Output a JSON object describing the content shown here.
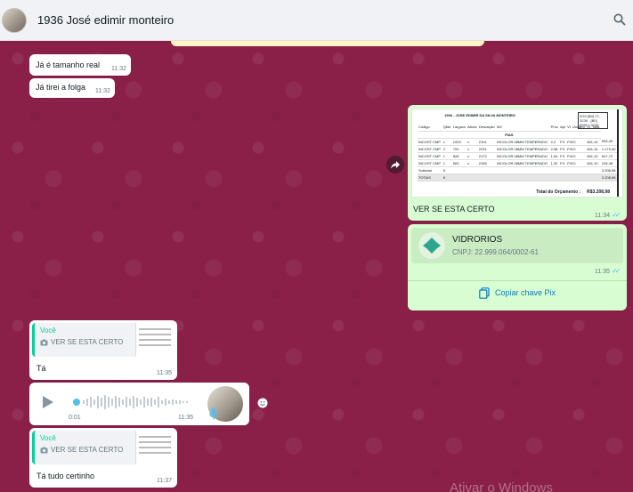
{
  "header": {
    "title": "1936 José edimir monteiro",
    "search_icon": "search-icon"
  },
  "messages": {
    "m1": {
      "text": "Já é tamanho real",
      "time": "11:32"
    },
    "m2": {
      "text": "Já tirei a folga",
      "time": "11:32"
    },
    "img": {
      "caption": "VER SE ESTA CERTO",
      "time": "11:34",
      "doc": {
        "title": "1936 - JOSE EDIMIR DA SILVA MONTEIRO",
        "code": "3/23 [B0] 17- 3239 - [B0] 00917-3239",
        "columns": [
          "Código",
          "Qtde",
          "Largura",
          "Altura",
          "Descrição",
          "M2",
          "Proc",
          "Apl",
          "Vl. Unitário",
          "Vl. Total"
        ],
        "group": "PIAS",
        "rows": [
          [
            "INCOST CMP",
            "1",
            "1003",
            "x",
            "2101",
            "INCOLOR 08MM TEMPERADO",
            "2,2",
            "FX",
            "FIXO",
            "461,10",
            "993,45"
          ],
          [
            "INCOST CMP",
            "2",
            "700",
            "x",
            "2231",
            "INCOLOR 08MM TEMPERADO",
            "2,98",
            "FX",
            "FIXO",
            "461,10",
            "1.179,39"
          ],
          [
            "INCOST CMP",
            "1",
            "826",
            "x",
            "2172",
            "INCOLOR 08MM TEMPERADO",
            "1,94",
            "FX",
            "FIXO",
            "461,10",
            "817,72"
          ],
          [
            "INCOST CMP",
            "1",
            "563",
            "x",
            "2155",
            "INCOLOR 08MM TEMPERADO",
            "1,32",
            "FX",
            "FIXO",
            "461,10",
            "228,48"
          ]
        ],
        "subtotal_label": "Subtotal",
        "subtotal_qty": "5",
        "subtotal_value": "3.208,98",
        "totais_label": "TOTAIS",
        "totais_qty": "5",
        "totais_value": "3.208,98",
        "total_label": "Total do Orçamento :",
        "total_value": "R$3.208,98"
      }
    },
    "pix": {
      "name": "VIDRORIOS",
      "cnpj": "CNPJ: 22.999.064/0002-61",
      "time": "11:35",
      "copy_label": "Copiar chave Pix"
    },
    "q1": {
      "author": "Você",
      "quoted_text": "VER SE ESTA CERTO",
      "text": "Tá",
      "time": "11:35"
    },
    "audio": {
      "duration": "0:01",
      "time": "11:35"
    },
    "q2": {
      "author": "Você",
      "quoted_text": "VER SE ESTA CERTO",
      "text": "Tá tudo certinho",
      "time": "11:37"
    }
  },
  "watermark": "Ativar o Windows",
  "colors": {
    "wallpaper": "#8a2048",
    "outgoing": "#d9fdd3",
    "incoming": "#ffffff",
    "accent": "#06cf9c",
    "link": "#027eb5"
  }
}
